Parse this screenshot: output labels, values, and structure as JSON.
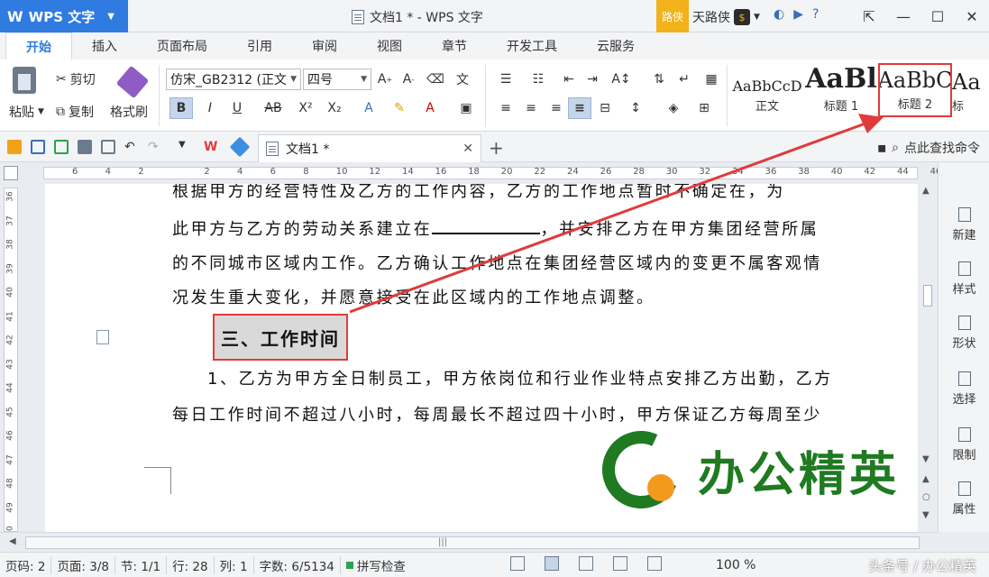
{
  "titlebar": {
    "app_name": "WPS 文字",
    "window_title": "文档1 * - WPS 文字",
    "badge": "路侠",
    "user": "天路侠"
  },
  "tabs": [
    "开始",
    "插入",
    "页面布局",
    "引用",
    "审阅",
    "视图",
    "章节",
    "开发工具",
    "云服务"
  ],
  "ribbon": {
    "paste": "粘贴",
    "cut": "剪切",
    "copy": "复制",
    "format_painter": "格式刷",
    "font_name": "仿宋_GB2312 (正文",
    "font_size": "四号",
    "styles": [
      {
        "sample": "AaBbCcD",
        "name": "正文"
      },
      {
        "sample": "AaBl",
        "name": "标题 1"
      },
      {
        "sample": "AaBbC",
        "name": "标题 2"
      },
      {
        "sample": "Aa",
        "name": "标"
      }
    ]
  },
  "quickbar": {
    "doc_tab": "文档1 *",
    "search": "点此查找命令"
  },
  "ruler": {
    "labels": [
      "6",
      "4",
      "2",
      "",
      "2",
      "4",
      "6",
      "8",
      "10",
      "12",
      "14",
      "16",
      "18",
      "20",
      "22",
      "24",
      "26",
      "28",
      "30",
      "32",
      "34",
      "36",
      "38",
      "40",
      "42",
      "44",
      "46"
    ]
  },
  "vruler": [
    "36",
    "37",
    "38",
    "39",
    "40",
    "41",
    "42",
    "43",
    "44",
    "45",
    "46",
    "47",
    "48",
    "49",
    "50"
  ],
  "document": {
    "lines": [
      "根据甲方的经营特性及乙方的工作内容，乙方的工作地点暂时不确定在，为",
      "的不同城市区域内工作。乙方确认工作地点在集团经营区域内的变更不属客观情",
      "况发生重大变化，并愿意接受在此区域内的工作地点调整。"
    ],
    "line2_pre": "此甲方与乙方的劳动关系建立在",
    "line2_post": "，并安排乙方在甲方集团经营所属",
    "heading": "三、工作时间",
    "para2": [
      "1、乙方为甲方全日制员工，甲方依岗位和行业作业特点安排乙方出勤，乙方",
      "每日工作时间不超过八小时，每周最长不超过四十小时，甲方保证乙方每周至少"
    ]
  },
  "watermark": "办公精英",
  "rightpane": [
    "新建",
    "样式",
    "形状",
    "选择",
    "限制",
    "属性"
  ],
  "status": {
    "page_code": "页码: 2",
    "pages": "页面: 3/8",
    "section": "节: 1/1",
    "row": "行: 28",
    "col": "列: 1",
    "words": "字数: 6/5134",
    "spell": "拼写检查",
    "zoom": "100 %",
    "credit": "头条号 / 办公精英"
  },
  "colors": {
    "accent": "#2f7be0",
    "highlight": "#e03b3b",
    "watermark_green": "#1f7a21",
    "watermark_orange": "#f39a1c"
  }
}
